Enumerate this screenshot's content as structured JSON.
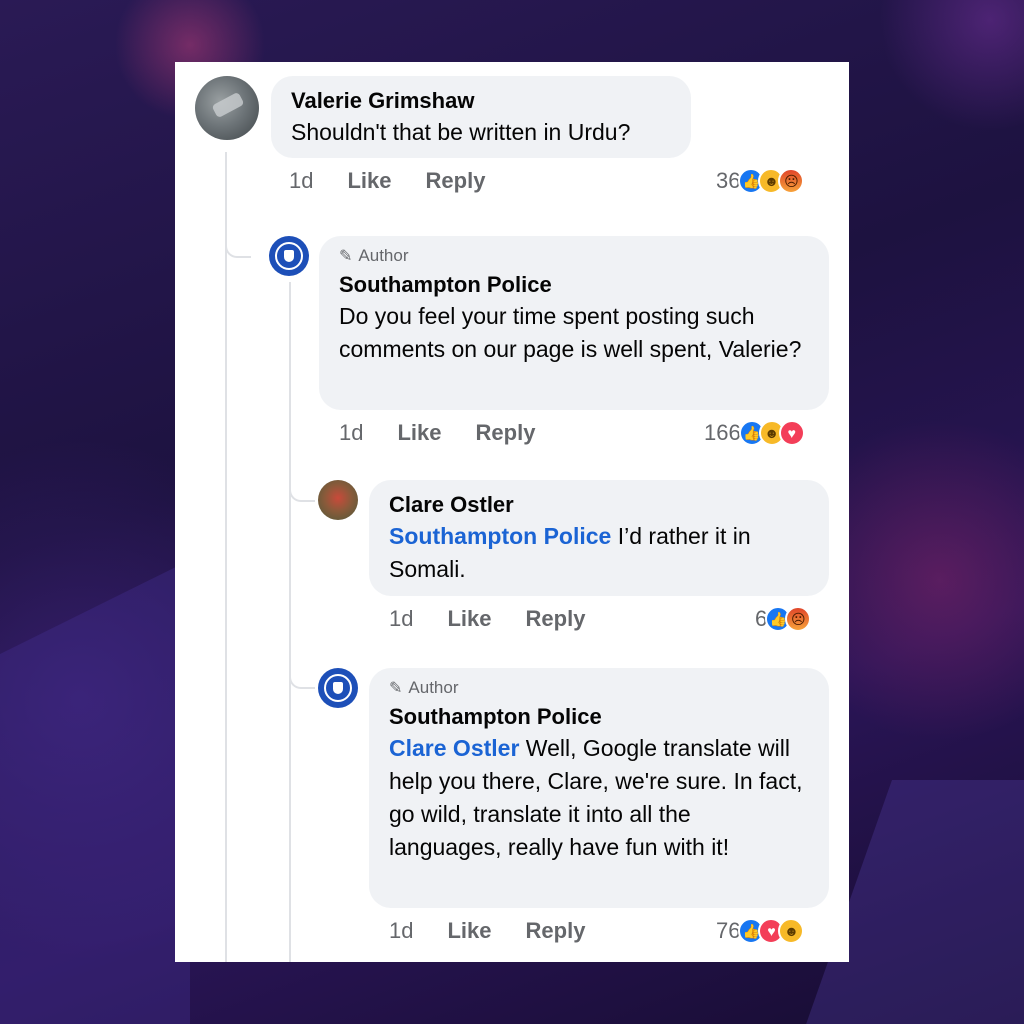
{
  "comments": [
    {
      "name": "Valerie Grimshaw",
      "text": "Shouldn't that be written in Urdu?",
      "time": "1d",
      "like_label": "Like",
      "reply_label": "Reply",
      "reaction_count": "36",
      "reactions": [
        "like-icon",
        "haha-icon",
        "angry-icon"
      ]
    },
    {
      "badge": "Author",
      "name": "Southampton Police",
      "text": "Do you feel your time spent posting such comments on our page is well spent, Valerie?",
      "time": "1d",
      "like_label": "Like",
      "reply_label": "Reply",
      "reaction_count": "166",
      "reactions": [
        "like-icon",
        "haha-icon",
        "love-icon"
      ]
    },
    {
      "name": "Clare Ostler",
      "mention": "Southampton Police",
      "text": " I’d rather it in Somali.",
      "time": "1d",
      "like_label": "Like",
      "reply_label": "Reply",
      "reaction_count": "6",
      "reactions": [
        "like-icon",
        "angry-icon"
      ]
    },
    {
      "badge": "Author",
      "name": "Southampton Police",
      "mention": "Clare Ostler",
      "text": " Well, Google translate will help you there, Clare, we're sure. In fact, go wild, translate it into all the languages, really have fun with it!",
      "time": "1d",
      "like_label": "Like",
      "reply_label": "Reply",
      "reaction_count": "76",
      "reactions": [
        "like-icon",
        "love-icon",
        "haha-icon"
      ]
    }
  ],
  "colors": {
    "mention": "#1b64d4",
    "bubble": "#f0f2f5",
    "like": "#1877f2",
    "love": "#f33e58",
    "haha": "#f7b928",
    "angry": "#e0452a"
  }
}
